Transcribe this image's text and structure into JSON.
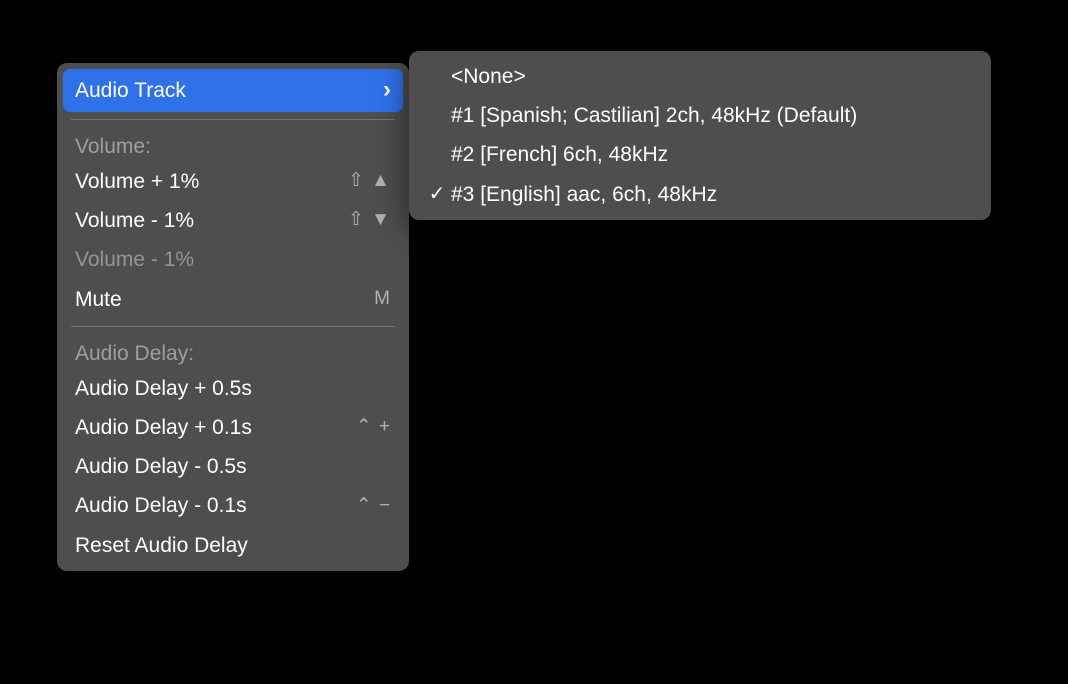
{
  "mainMenu": {
    "audioTrack": "Audio Track",
    "volumeHeader": "Volume:",
    "volUp": "Volume + 1%",
    "volUpKey": "⇧ ▲",
    "volDown": "Volume - 1%",
    "volDownKey": "⇧ ▼",
    "volDownDisabled": "Volume - 1%",
    "mute": "Mute",
    "muteKey": "M",
    "delayHeader": "Audio Delay:",
    "delayUp05": "Audio Delay + 0.5s",
    "delayUp01": "Audio Delay + 0.1s",
    "delayUp01Key": "⌃ +",
    "delayDown05": "Audio Delay - 0.5s",
    "delayDown01": "Audio Delay - 0.1s",
    "delayDown01Key": "⌃ −",
    "resetDelay": "Reset Audio Delay"
  },
  "subMenu": {
    "none": "<None>",
    "t1": "#1 [Spanish; Castilian] 2ch, 48kHz (Default)",
    "t2": "#2 [French] 6ch, 48kHz",
    "t3": "#3 [English] aac, 6ch, 48kHz",
    "checkmark": "✓"
  }
}
